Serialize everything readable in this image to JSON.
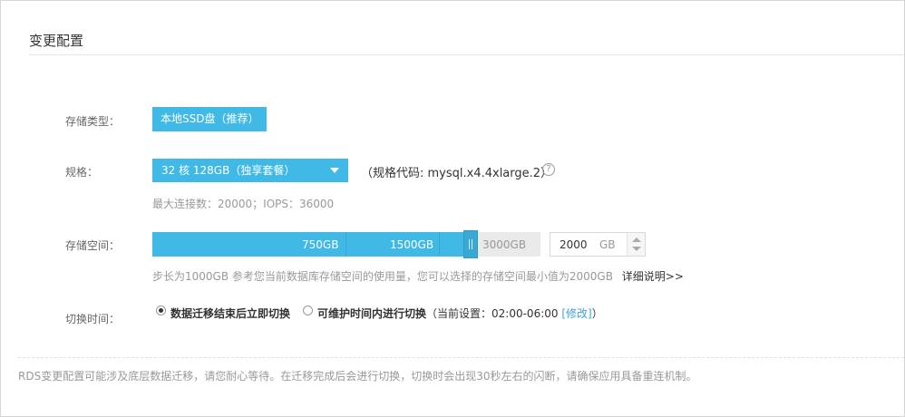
{
  "title": "变更配置",
  "storage_type": {
    "label": "存储类型：",
    "value": "本地SSD盘（推荐）"
  },
  "spec": {
    "label": "规格：",
    "selected": "32 核 128GB（独享套餐）",
    "code_text": "（规格代码: mysql.x4.4xlarge.2）",
    "hint": "最大连接数：20000；IOPS：36000"
  },
  "storage_space": {
    "label": "存储空间：",
    "ticks": [
      "750GB",
      "1500GB",
      "3000GB"
    ],
    "value": "2000",
    "unit": "GB",
    "max": 3000,
    "hint": "步长为1000GB 参考您当前数据库存储空间的使用量，您可以选择的存储空间最小值为2000GB",
    "detail_link": "详细说明>>"
  },
  "switch_time": {
    "label": "切换时间：",
    "option1": "数据迁移结束后立即切换",
    "option2": "可维护时间内进行切换",
    "current_prefix": "（当前设置：02:00-06:00 ",
    "modify": "[修改]",
    "current_suffix": "）"
  },
  "note": "RDS变更配置可能涉及底层数据迁移，请您耐心等待。在迁移完成后会进行切换，切换时会出现30秒左右的闪断，请确保应用具备重连机制。"
}
